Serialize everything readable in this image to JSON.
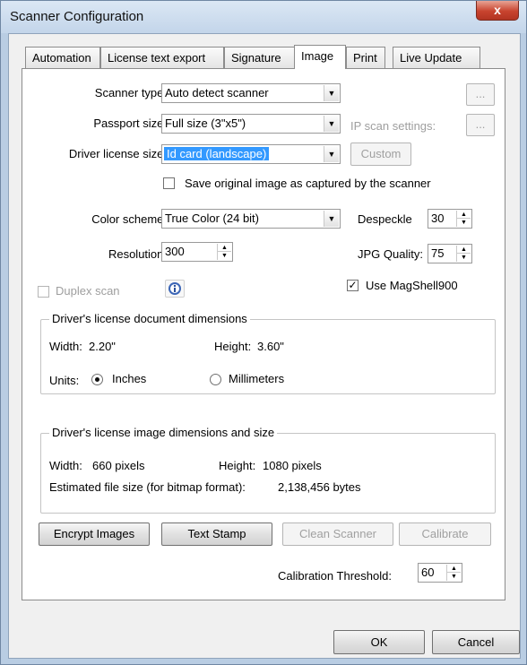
{
  "window": {
    "title": "Scanner Configuration",
    "close_glyph": "x"
  },
  "tabs": [
    "Automation",
    "License text export",
    "Signature",
    "Image",
    "Print",
    "Live Update"
  ],
  "form": {
    "scanner_type_label": "Scanner type:",
    "scanner_type_value": "Auto detect scanner",
    "scanner_settings_button": "...",
    "passport_size_label": "Passport size:",
    "passport_size_value": "Full size (3\"x5\")",
    "ip_scan_settings_label": "IP scan settings:",
    "ip_scan_button": "...",
    "driver_license_size_label": "Driver license size:",
    "driver_license_size_value": "Id card (landscape)",
    "custom_button": "Custom",
    "save_original_label": "Save original image as captured by the scanner",
    "save_original_checked": false,
    "color_scheme_label": "Color scheme:",
    "color_scheme_value": "True Color (24 bit)",
    "despeckle_label": "Despeckle",
    "despeckle_value": "30",
    "resolution_label": "Resolution:",
    "resolution_value": "300",
    "jpg_quality_label": "JPG Quality:",
    "jpg_quality_value": "75",
    "duplex_label": "Duplex scan",
    "duplex_checked": false,
    "use_magshell_label": "Use MagShell900",
    "use_magshell_checked": true,
    "check_mark": "✓"
  },
  "doc_dimensions": {
    "title": "Driver's license document dimensions",
    "width_label": "Width:",
    "width_value": "2.20\"",
    "height_label": "Height:",
    "height_value": "3.60\"",
    "units_label": "Units:",
    "inches_label": "Inches",
    "millimeters_label": "Millimeters",
    "selected_unit": "Inches"
  },
  "img_dimensions": {
    "title": "Driver's license image dimensions and size",
    "width_label": "Width:",
    "width_value": "660 pixels",
    "height_label": "Height:",
    "height_value": "1080 pixels",
    "file_size_label": "Estimated file size (for bitmap format):",
    "file_size_value": "2,138,456 bytes"
  },
  "buttons": {
    "encrypt_images": "Encrypt Images",
    "text_stamp": "Text Stamp",
    "clean_scanner": "Clean Scanner",
    "calibrate": "Calibrate"
  },
  "calibration": {
    "label": "Calibration Threshold:",
    "value": "60"
  },
  "footer": {
    "ok": "OK",
    "cancel": "Cancel"
  },
  "icons": {
    "info": "info-icon",
    "close": "close-icon",
    "dropdown": "chevron-down-icon"
  },
  "colors": {
    "accent_selection": "#3399ff",
    "close_button": "#c8432e"
  }
}
